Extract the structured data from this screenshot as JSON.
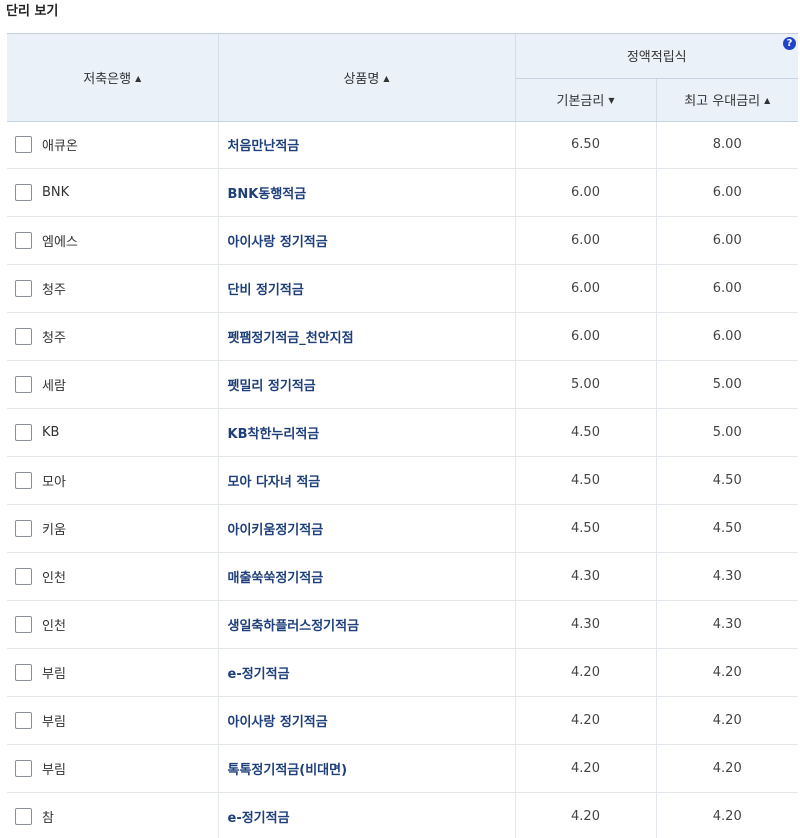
{
  "section_title": "단리 보기",
  "header": {
    "bank_col": "저축은행",
    "product_col": "상품명",
    "group_col": "정액적립식",
    "base_rate_col": "기본금리",
    "max_rate_col": "최고 우대금리",
    "sort_up": "▲",
    "sort_down": "▼",
    "help": "?"
  },
  "rows": [
    {
      "bank": "애큐온",
      "product": "처음만난적금",
      "base": "6.50",
      "max": "8.00"
    },
    {
      "bank": "BNK",
      "product": "BNK동행적금",
      "base": "6.00",
      "max": "6.00"
    },
    {
      "bank": "엠에스",
      "product": "아이사랑 정기적금",
      "base": "6.00",
      "max": "6.00"
    },
    {
      "bank": "청주",
      "product": "단비 정기적금",
      "base": "6.00",
      "max": "6.00"
    },
    {
      "bank": "청주",
      "product": "펫팸정기적금_천안지점",
      "base": "6.00",
      "max": "6.00"
    },
    {
      "bank": "세람",
      "product": "펫밀리 정기적금",
      "base": "5.00",
      "max": "5.00"
    },
    {
      "bank": "KB",
      "product": "KB착한누리적금",
      "base": "4.50",
      "max": "5.00"
    },
    {
      "bank": "모아",
      "product": "모아 다자녀 적금",
      "base": "4.50",
      "max": "4.50"
    },
    {
      "bank": "키움",
      "product": "아이키움정기적금",
      "base": "4.50",
      "max": "4.50"
    },
    {
      "bank": "인천",
      "product": "매출쑥쑥정기적금",
      "base": "4.30",
      "max": "4.30"
    },
    {
      "bank": "인천",
      "product": "생일축하플러스정기적금",
      "base": "4.30",
      "max": "4.30"
    },
    {
      "bank": "부림",
      "product": "e-정기적금",
      "base": "4.20",
      "max": "4.20"
    },
    {
      "bank": "부림",
      "product": "아이사랑 정기적금",
      "base": "4.20",
      "max": "4.20"
    },
    {
      "bank": "부림",
      "product": "톡톡정기적금(비대면)",
      "base": "4.20",
      "max": "4.20"
    },
    {
      "bank": "참",
      "product": "e-정기적금",
      "base": "4.20",
      "max": "4.20"
    }
  ]
}
